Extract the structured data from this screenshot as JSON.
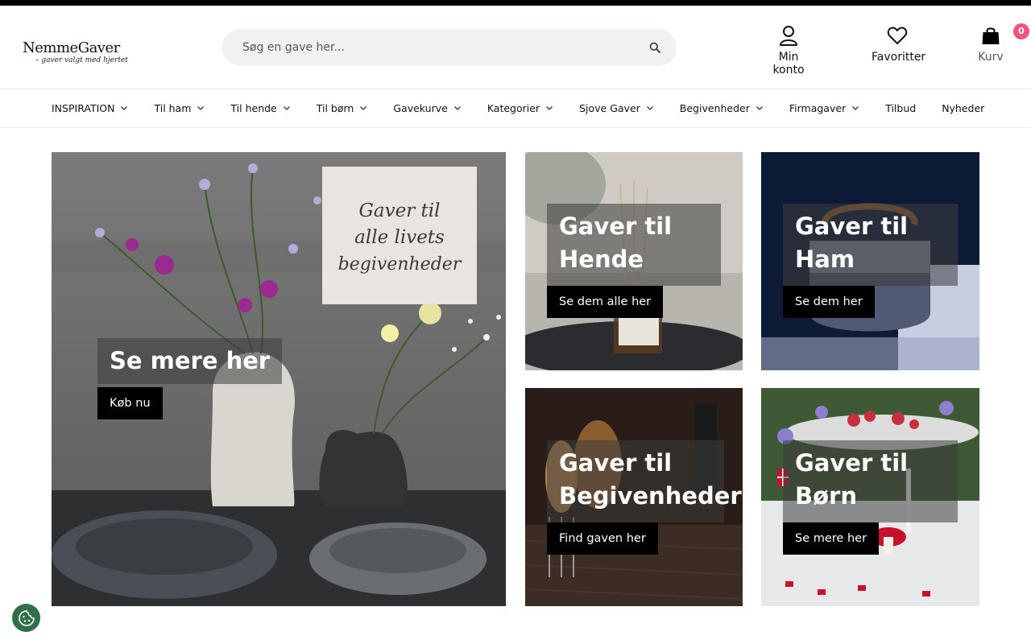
{
  "header": {
    "logo_main": "NemmeGaver",
    "logo_tagline": "– gaver valgt med hjertet",
    "search_placeholder": "Søg en gave her...",
    "account_label": "Min konto",
    "favorites_label": "Favoritter",
    "cart_label": "Kurv",
    "cart_count": "0",
    "icons": {
      "search": "search-icon",
      "account": "user-icon",
      "favorites": "heart-icon",
      "cart": "shopping-bag-icon"
    }
  },
  "nav": {
    "items": [
      {
        "label": "INSPIRATION",
        "dropdown": true
      },
      {
        "label": "Til ham",
        "dropdown": true
      },
      {
        "label": "Til hende",
        "dropdown": true
      },
      {
        "label": "Til børn",
        "dropdown": true
      },
      {
        "label": "Gavekurve",
        "dropdown": true
      },
      {
        "label": "Kategorier",
        "dropdown": true
      },
      {
        "label": "Sjove Gaver",
        "dropdown": true
      },
      {
        "label": "Begivenheder",
        "dropdown": true
      },
      {
        "label": "Firmagaver",
        "dropdown": true
      },
      {
        "label": "Tilbud",
        "dropdown": false
      },
      {
        "label": "Nyheder",
        "dropdown": false
      }
    ]
  },
  "hero": {
    "sign_text": "Gaver til alle livets begivenheder",
    "caption": "Se mere her",
    "button": "Køb nu"
  },
  "tiles": [
    {
      "caption": "Gaver til Hende",
      "button": "Se dem alle her"
    },
    {
      "caption": "Gaver til Ham",
      "button": "Se dem her"
    },
    {
      "caption": "Gaver til Begivenheder",
      "button": "Find gaven her"
    },
    {
      "caption": "Gaver til Børn",
      "button": "Se mere her"
    }
  ],
  "colors": {
    "accent": "#f2557a",
    "cookie": "#2f6f4a",
    "button": "#000000"
  }
}
